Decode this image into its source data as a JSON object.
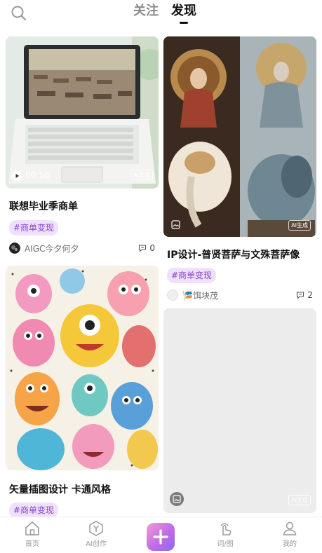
{
  "header": {
    "tabs": [
      {
        "label": "关注",
        "active": false
      },
      {
        "label": "发现",
        "active": true
      }
    ]
  },
  "feed": {
    "cards": [
      {
        "title": "联想毕业季商单",
        "tag": "#商单变现",
        "author": "AIGC今夕何夕",
        "comments": "0",
        "video_duration": "00:56",
        "badge": "AI生成",
        "image": "laptop-classroom"
      },
      {
        "title": "IP设计-普贤菩萨与文殊菩萨像",
        "tag": "#商单变现",
        "author": "🎏饵块茂",
        "comments": "2",
        "badge": "AI生成",
        "image": "bodhisattva-statues"
      },
      {
        "title": "矢量插图设计 卡通风格",
        "tag": "#商单变现",
        "image": "cartoon-monsters"
      },
      {
        "badge": "AI生成",
        "image": "loading-placeholder"
      }
    ]
  },
  "bottom_nav": {
    "items": [
      {
        "label": "首页",
        "icon": "home-icon"
      },
      {
        "label": "AI创作",
        "icon": "ai-create-icon"
      },
      {
        "label": "",
        "icon": "plus-icon"
      },
      {
        "label": "词/图",
        "icon": "prompt-icon"
      },
      {
        "label": "我的",
        "icon": "profile-icon"
      }
    ]
  },
  "colors": {
    "tag_bg": "#efe1fb",
    "tag_text": "#8a47c9",
    "accent_gradient_start": "#f39ad3",
    "accent_gradient_end": "#8a6af2"
  }
}
